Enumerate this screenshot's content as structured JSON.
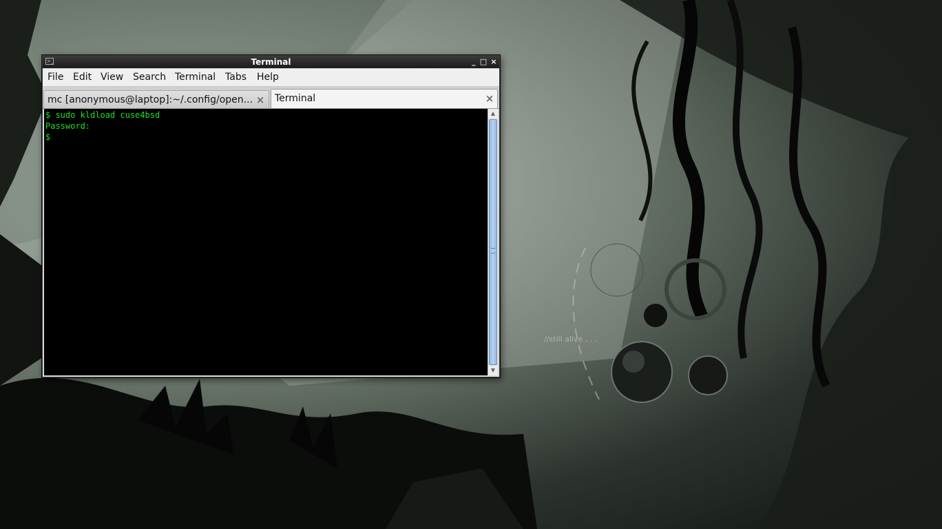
{
  "window": {
    "title": "Terminal",
    "minimize_glyph": "_",
    "maximize_glyph": "□",
    "close_glyph": "×"
  },
  "menu": {
    "items": [
      "File",
      "Edit",
      "View",
      "Search",
      "Terminal",
      "Tabs",
      "Help"
    ]
  },
  "tabs": [
    {
      "label": "mc [anonymous@laptop]:~/.config/open...",
      "active": false,
      "close_glyph": "×"
    },
    {
      "label": "Terminal",
      "active": true,
      "close_glyph": "×"
    }
  ],
  "terminal": {
    "lines": [
      "$ sudo kldload cuse4bsd",
      "Password:",
      "$"
    ],
    "text_color": "#1ee01e",
    "background": "#000000"
  },
  "scrollbar": {
    "up_glyph": "▲",
    "down_glyph": "▼"
  },
  "wallpaper": {
    "text": "//still alive . . ."
  },
  "colors": {
    "titlebar": "#1c1c1c",
    "scroll_thumb": "#a3c4ea"
  }
}
